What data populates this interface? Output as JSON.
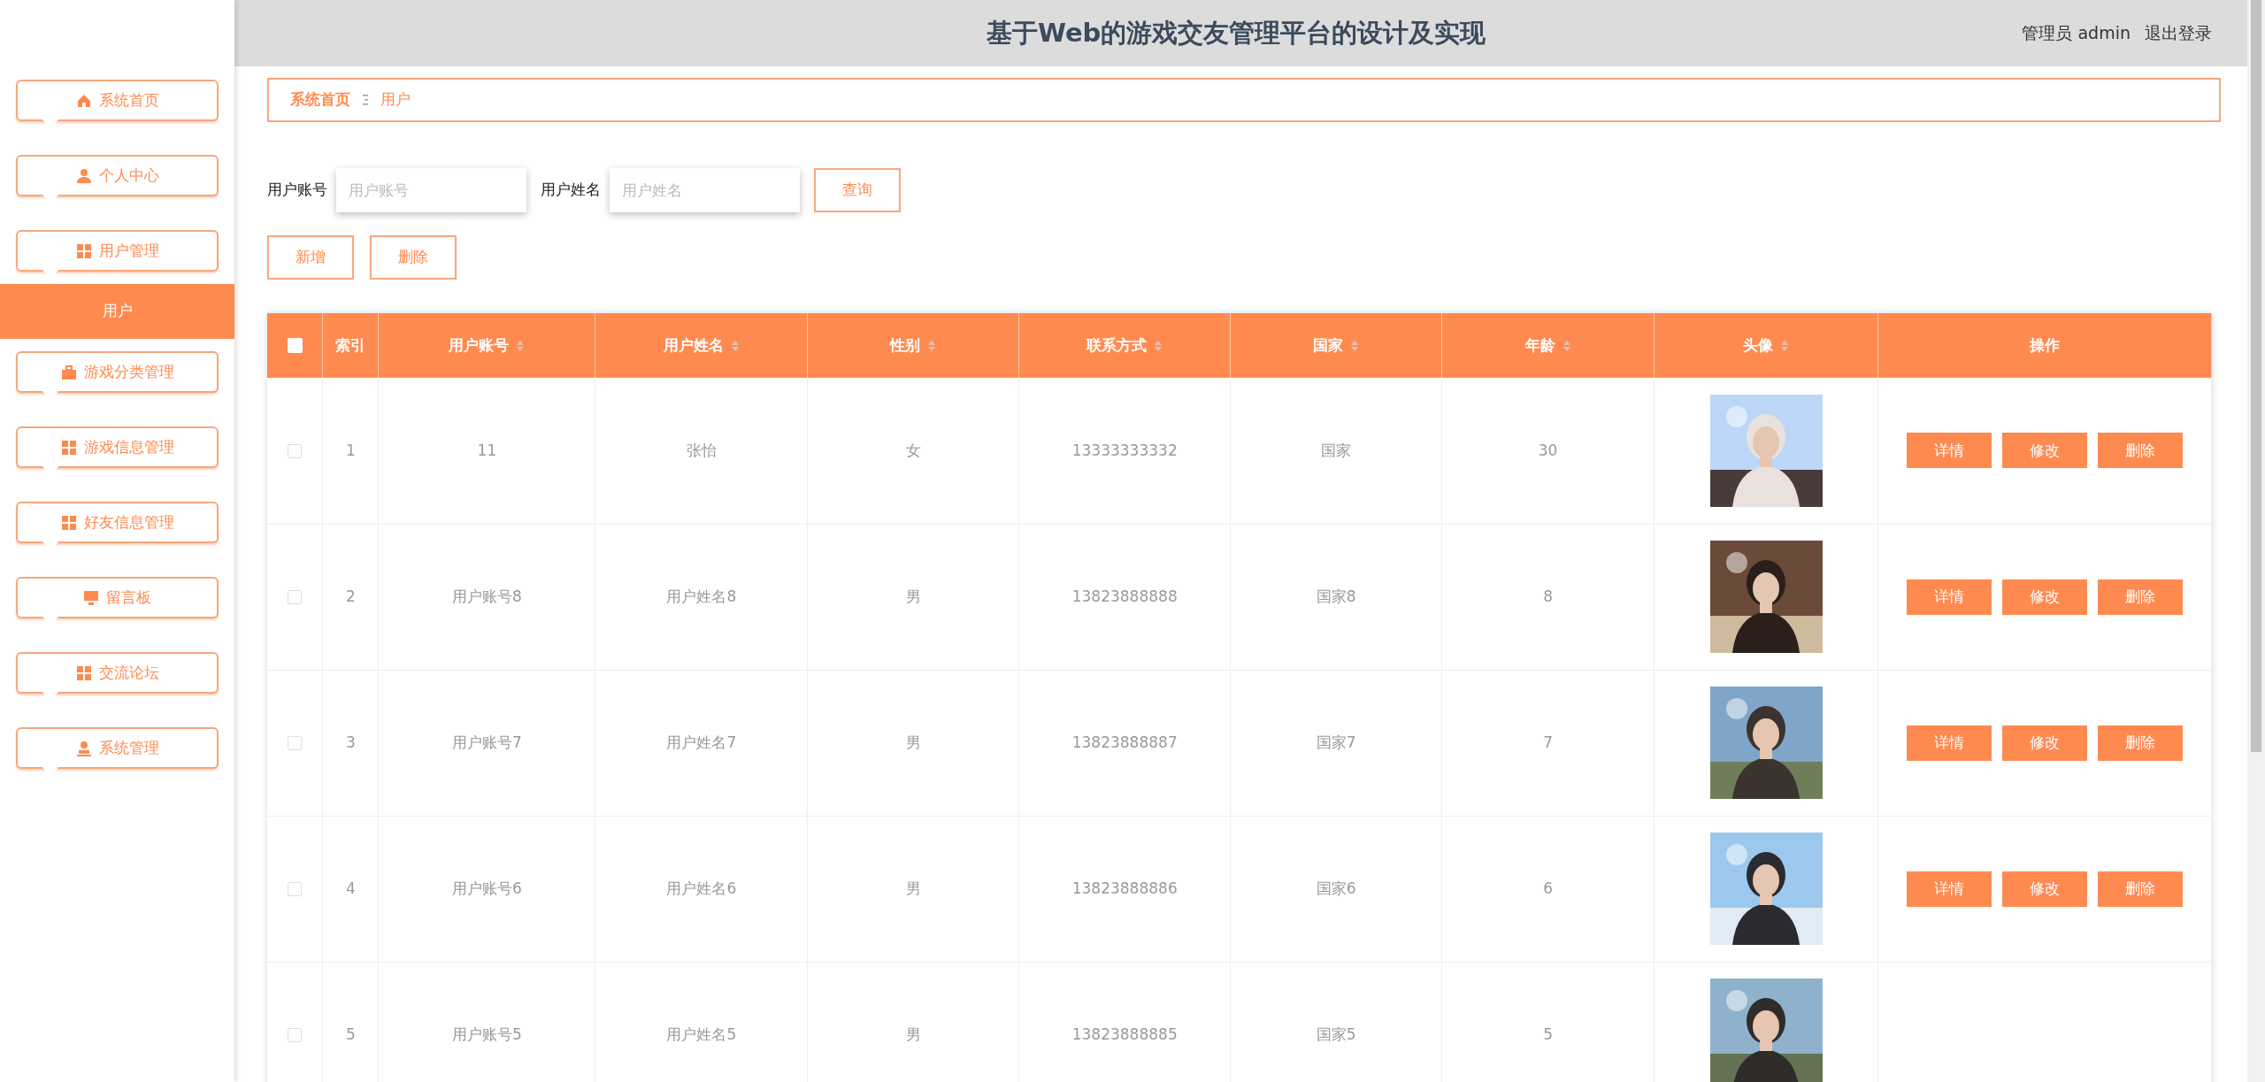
{
  "header": {
    "title": "基于Web的游戏交友管理平台的设计及实现",
    "user": "管理员 admin",
    "logout": "退出登录"
  },
  "sidebar": {
    "items": [
      {
        "label": "系统首页"
      },
      {
        "label": "个人中心"
      },
      {
        "label": "用户管理",
        "children": [
          {
            "label": "用户",
            "selected": true
          }
        ]
      },
      {
        "label": "游戏分类管理"
      },
      {
        "label": "游戏信息管理"
      },
      {
        "label": "好友信息管理"
      },
      {
        "label": "留言板"
      },
      {
        "label": "交流论坛"
      },
      {
        "label": "系统管理"
      }
    ]
  },
  "breadcrumb": [
    "系统首页",
    "用户"
  ],
  "search": {
    "fields": [
      {
        "label": "用户账号",
        "placeholder": "用户账号"
      },
      {
        "label": "用户姓名",
        "placeholder": "用户姓名"
      }
    ],
    "button": "查询"
  },
  "actions": [
    "新增",
    "删除"
  ],
  "table": {
    "select_all": {
      "checked": false
    },
    "columns": [
      {
        "label": "索引",
        "sortable": false
      },
      {
        "label": "用户账号",
        "sortable": true
      },
      {
        "label": "用户姓名",
        "sortable": true
      },
      {
        "label": "性别",
        "sortable": true
      },
      {
        "label": "联系方式",
        "sortable": true
      },
      {
        "label": "国家",
        "sortable": true
      },
      {
        "label": "年龄",
        "sortable": true
      },
      {
        "label": "头像",
        "sortable": true
      },
      {
        "label": "操作",
        "sortable": false
      }
    ],
    "rows": [
      {
        "checked": false,
        "cells": [
          "1",
          "11",
          "张怡",
          "女",
          "13333333332",
          "国家",
          "30"
        ],
        "avatar": {
          "kind": "picture"
        },
        "buttons": [
          "详情",
          "修改",
          "删除"
        ]
      },
      {
        "checked": false,
        "cells": [
          "2",
          "用户账号8",
          "用户姓名8",
          "男",
          "13823888888",
          "国家8",
          "8"
        ],
        "avatar": {
          "kind": "picture"
        },
        "buttons": [
          "详情",
          "修改",
          "删除"
        ]
      },
      {
        "checked": false,
        "cells": [
          "3",
          "用户账号7",
          "用户姓名7",
          "男",
          "13823888887",
          "国家7",
          "7"
        ],
        "avatar": {
          "kind": "picture"
        },
        "buttons": [
          "详情",
          "修改",
          "删除"
        ]
      },
      {
        "checked": false,
        "cells": [
          "4",
          "用户账号6",
          "用户姓名6",
          "男",
          "13823888886",
          "国家6",
          "6"
        ],
        "avatar": {
          "kind": "picture"
        },
        "buttons": [
          "详情",
          "修改",
          "删除"
        ]
      },
      {
        "checked": false,
        "cells": [
          "5",
          "用户账号5",
          "用户姓名5",
          "男",
          "13823888885",
          "国家5",
          "5"
        ],
        "avatar": {
          "kind": "picture"
        },
        "buttons": []
      }
    ]
  }
}
